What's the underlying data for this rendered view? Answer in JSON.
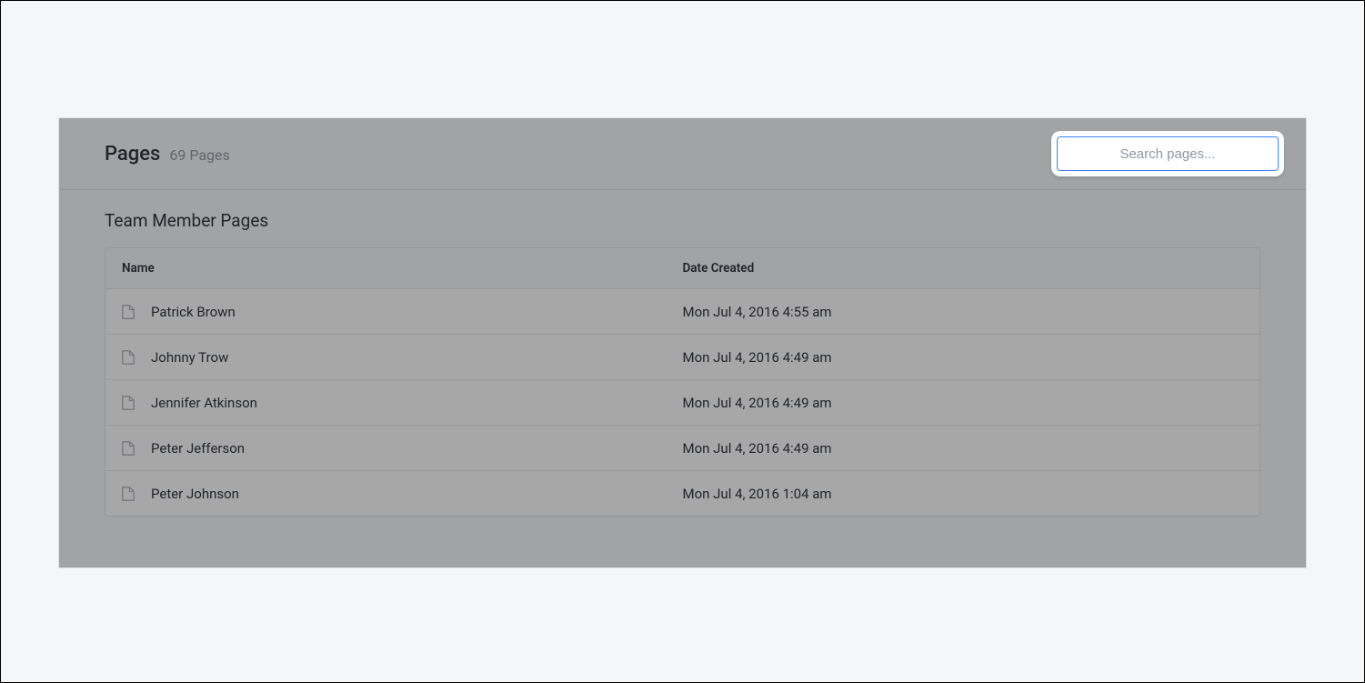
{
  "header": {
    "title": "Pages",
    "count_label": "69 Pages"
  },
  "search": {
    "placeholder": "Search pages...",
    "value": ""
  },
  "section": {
    "title": "Team Member Pages"
  },
  "table": {
    "columns": {
      "name": "Name",
      "date": "Date Created"
    },
    "rows": [
      {
        "name": "Patrick Brown",
        "date": "Mon Jul 4, 2016 4:55 am"
      },
      {
        "name": "Johnny Trow",
        "date": "Mon Jul 4, 2016 4:49 am"
      },
      {
        "name": "Jennifer Atkinson",
        "date": "Mon Jul 4, 2016 4:49 am"
      },
      {
        "name": "Peter Jefferson",
        "date": "Mon Jul 4, 2016 4:49 am"
      },
      {
        "name": "Peter Johnson",
        "date": "Mon Jul 4, 2016 1:04 am"
      }
    ]
  }
}
